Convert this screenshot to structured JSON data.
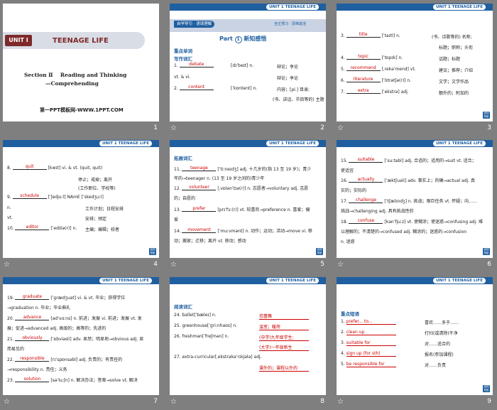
{
  "slides": [
    {
      "num": "1",
      "unit": "UNIT Ⅰ",
      "title": "TEENAGE LIFE",
      "section": "Section Ⅱ    Reading and Thinking",
      "subsection": "—Comprehending",
      "website": "第一PPT模板网-WWW.1PPT.COM"
    },
    {
      "num": "2",
      "badge": "UNIT 1   TEENAGE LIFE",
      "tag": "自学导引 · 语境理解",
      "tag2": "自主预习 · 思维激活",
      "part": "Part",
      "part_num": "1",
      "part_title": "新知感悟",
      "h1": "重点单词",
      "h2": "写作词汇",
      "rows": [
        {
          "n": "1.",
          "ans": "debate",
          "phon": "[dɪˈbeɪt] n.",
          "mean": "辩论；争论"
        },
        {
          "n": "",
          "ans": "",
          "phon": "vt. & vi.",
          "mean": "辩论；争论"
        },
        {
          "n": "2.",
          "ans": "content",
          "phon": "[ˈkɒntent] n.",
          "mean": "内容；[pl.] 目录;"
        },
        {
          "n": "",
          "ans": "",
          "phon": "",
          "mean": "(书、讲话、节目等的) 主题"
        }
      ]
    },
    {
      "num": "3",
      "badge": "UNIT 1   TEENAGE LIFE",
      "rows": [
        {
          "n": "3.",
          "ans": "title",
          "phon": "[ˈtaɪtl] n.",
          "mean": "(书、诗歌等的) 名称;"
        },
        {
          "n": "",
          "ans": "",
          "phon": "",
          "mean": "标题；职称；头衔"
        },
        {
          "n": "4.",
          "ans": "topic",
          "phon": "[ˈtɒpɪk] n.",
          "mean": "话题；标题"
        },
        {
          "n": "5.",
          "ans": "recommend",
          "phon": "[ˌrekəˈmend] vt.",
          "mean": "建议；推荐；介绍"
        },
        {
          "n": "6.",
          "ans": "literature",
          "phon": "[ˈlɪtrətʃə(r)] n.",
          "mean": "文学；文学作品"
        },
        {
          "n": "7.",
          "ans": "extra",
          "phon": "[ˈekstrə] adj.",
          "mean": "额外的；附加的"
        }
      ]
    },
    {
      "num": "4",
      "badge": "UNIT 1   TEENAGE LIFE",
      "rows": [
        {
          "n": "8.",
          "ans": "quit",
          "phon": "[kwɪt] vi. & vt. (quit, quit)",
          "mean": ""
        },
        {
          "n": "",
          "ans": "",
          "phon": "",
          "mean": "停止；戒掉；离开"
        },
        {
          "n": "",
          "ans": "",
          "phon": "",
          "mean": "(工作职位、学校等)"
        },
        {
          "n": "9.",
          "ans": "schedule",
          "phon": "[ˈʃedjuːl] NAmE [ˈskedʒuːl]",
          "mean": ""
        },
        {
          "n": "",
          "ans": "",
          "phon": "n.",
          "mean": "工作计划；日程安排"
        },
        {
          "n": "",
          "ans": "",
          "phon": "vt.",
          "mean": "安排；预定"
        },
        {
          "n": "10.",
          "ans": "editor",
          "phon": "[ˈedɪtə(r)] n.",
          "mean": "主编；编辑；校者"
        }
      ]
    },
    {
      "num": "5",
      "badge": "UNIT 1   TEENAGE LIFE",
      "h1": "拓展词汇",
      "rows": [
        {
          "n": "11.",
          "ans": "teenage",
          "text": "[ˈtiːneɪdʒ] adj. 十几岁的(指 13 至 19 岁)；青少"
        },
        {
          "n": "",
          "ans": "",
          "text": "年的→teenager n. (13 至 19 岁之间的)青少年"
        },
        {
          "n": "12.",
          "ans": "volunteer",
          "text": "[ˌvɒlənˈtɪə(r)] n. 志愿者→voluntary adj. 志愿"
        },
        {
          "n": "",
          "ans": "",
          "text": "的；自愿的"
        },
        {
          "n": "13.",
          "ans": "prefer",
          "text": "[prɪˈfɜː(r)] vt. 较喜欢→preference n. 喜爱；偏"
        },
        {
          "n": "",
          "ans": "",
          "text": "爱"
        },
        {
          "n": "14.",
          "ans": "movement",
          "text": "[ˈmuːvmənt] n. 动作；运动；活动→move vi. 移"
        },
        {
          "n": "",
          "ans": "",
          "text": "动；搬家；迁移；离开 vt. 移动；感动"
        }
      ]
    },
    {
      "num": "6",
      "badge": "UNIT 1   TEENAGE LIFE",
      "rows": [
        {
          "n": "15.",
          "ans": "suitable",
          "text": "[ˈsuːtəbl] adj. 合适的；适用的→suit vt. 适合；"
        },
        {
          "n": "",
          "ans": "",
          "text": "使适宜"
        },
        {
          "n": "16.",
          "ans": "actually",
          "text": "[ˈæktʃuəli] adv. 事实上；的确→actual adj. 真"
        },
        {
          "n": "",
          "ans": "",
          "text": "实的；实际的"
        },
        {
          "n": "17.",
          "ans": "challenge",
          "text": "[ˈtʃælɪndʒ] n. 挑战；艰巨任务 vt. 怀疑；向……"
        },
        {
          "n": "",
          "ans": "",
          "text": "挑战→challenging adj. 具有挑战性的"
        },
        {
          "n": "18.",
          "ans": "confuse",
          "text": "[kənˈfjuːz] vt. 使糊涂；使迷惑→confusing adj. 难"
        },
        {
          "n": "",
          "ans": "",
          "text": "以理解的；不清楚的→confused adj. 糊涂的；迷惑的→confusion"
        },
        {
          "n": "",
          "ans": "",
          "text": "n. 迷惑"
        }
      ]
    },
    {
      "num": "7",
      "badge": "UNIT 1   TEENAGE LIFE",
      "rows": [
        {
          "n": "19.",
          "ans": "graduate",
          "text": "[ˈɡrædʒuət] vi. & vt. 毕业；获得学位"
        },
        {
          "n": "",
          "ans": "",
          "text": "→graduation n. 毕业；毕业典礼"
        },
        {
          "n": "20.",
          "ans": "advance",
          "text": "[ədˈvɑːns] n. 前进；发展 vi. 前进；发展 vt. 发"
        },
        {
          "n": "",
          "ans": "",
          "text": "展；促进→advanced adj. 高级的；高等的；先进的"
        },
        {
          "n": "21.",
          "ans": "obviously",
          "text": "[ˈɒbviəsli] adv. 显然；明显地→obvious adj. 显"
        },
        {
          "n": "",
          "ans": "",
          "text": "而易见的"
        },
        {
          "n": "22.",
          "ans": "responsible",
          "text": "[rɪˈspɒnsəbl] adj. 负责的；有责任的"
        },
        {
          "n": "",
          "ans": "",
          "text": "→responsibility n. 责任；义务"
        },
        {
          "n": "23.",
          "ans": "solution",
          "text": "[səˈluːʃn] n. 解决办法；答案→solve vt. 解决"
        }
      ]
    },
    {
      "num": "8",
      "badge": "UNIT 1   TEENAGE LIFE",
      "h1": "阅读词汇",
      "rows": [
        {
          "n": "24.",
          "text": "ballet[ˈbæleɪ] n.",
          "ans": "芭蕾舞"
        },
        {
          "n": "25.",
          "text": "greenhouse[ˈɡriːnhaʊs] n.",
          "ans": "温室；暖房"
        },
        {
          "n": "26.",
          "text": "freshman[ˈfreʃmən] n.",
          "ans": "(中学)九年级学生;"
        },
        {
          "n": "",
          "text": "",
          "ans": "(大学)一年级新生"
        },
        {
          "n": "27.",
          "text": "extra-curricular[ˌekstrəkəˈrɪkjələ] adj.",
          "ans": ""
        },
        {
          "n": "",
          "text": "",
          "ans": "课外的；课程以外的"
        }
      ]
    },
    {
      "num": "9",
      "badge": "UNIT 1   TEENAGE LIFE",
      "h1": "重点短语",
      "rows": [
        {
          "n": "1.",
          "ans": "prefer... to...",
          "mean": "喜欢……多于……"
        },
        {
          "n": "2.",
          "ans": "clean up",
          "mean": "打扫(或清除)干净"
        },
        {
          "n": "3.",
          "ans": "suitable for",
          "mean": "对……适合的"
        },
        {
          "n": "4.",
          "ans": "sign up (for sth)",
          "mean": "报名(参加课程)"
        },
        {
          "n": "5.",
          "ans": "be responsible for",
          "mean": "对……负责"
        }
      ]
    }
  ],
  "corner_icon": "page-icon",
  "footer_icon": "star-icon"
}
